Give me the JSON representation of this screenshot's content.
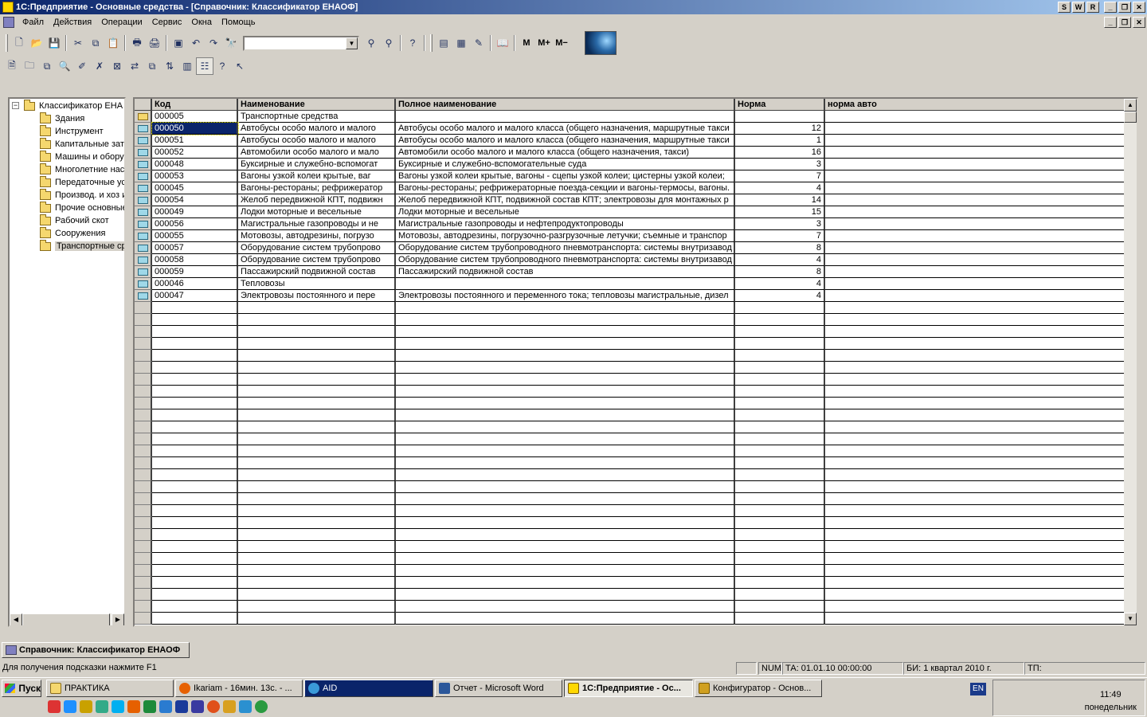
{
  "window": {
    "title": "1С:Предприятие - Основные средства - [Справочник: Классификатор ЕНАОФ]",
    "ctrl_buttons": [
      "S",
      "W",
      "R"
    ]
  },
  "menu": [
    "Файл",
    "Действия",
    "Операции",
    "Сервис",
    "Окна",
    "Помощь"
  ],
  "toolbar": {
    "m_label": "M",
    "mplus_label": "M+",
    "mminus_label": "M−"
  },
  "tree": {
    "root": "Классификатор ЕНА",
    "items": [
      "Здания",
      "Инструмент",
      "Капитальные зат",
      "Машины и обору",
      "Многолетние нас",
      "Передаточные ус",
      "Производ. и хоз и",
      "Прочие основные",
      "Рабочий скот",
      "Сооружения",
      "Транспортные ср"
    ]
  },
  "grid": {
    "columns": [
      "Код",
      "Наименование",
      "Полное наименование",
      "Норма",
      "норма авто"
    ],
    "rows": [
      {
        "code": "000005",
        "name": "Транспортные средства",
        "full": "",
        "norm": ""
      },
      {
        "code": "000050",
        "name": "Автобусы особо малого и малого",
        "full": "Автобусы особо малого и малого класса (общего назначения, маршрутные такси",
        "norm": "12"
      },
      {
        "code": "000051",
        "name": "Автобусы особо малого и малого",
        "full": "Автобусы особо малого и малого класса (общего назначения, маршрутные такси",
        "norm": "1"
      },
      {
        "code": "000052",
        "name": "Автомобили особо малого и мало",
        "full": "Автомобили особо малого и малого класса (общего назначения, такси)",
        "norm": "16"
      },
      {
        "code": "000048",
        "name": "Буксирные и служебно-вспомогат",
        "full": "Буксирные и служебно-вспомогательные суда",
        "norm": "3"
      },
      {
        "code": "000053",
        "name": "Вагоны узкой колеи крытые, ваг",
        "full": "Вагоны узкой колеи крытые, вагоны - сцепы узкой колеи; цистерны узкой колеи;",
        "norm": "7"
      },
      {
        "code": "000045",
        "name": "Вагоны-рестораны; рефрижератор",
        "full": "Вагоны-рестораны; рефрижераторные поезда-секции и вагоны-термосы, вагоны.",
        "norm": "4"
      },
      {
        "code": "000054",
        "name": "Желоб передвижной КПТ, подвижн",
        "full": "Желоб передвижной КПТ, подвижной состав КПТ; электровозы для монтажных р",
        "norm": "14"
      },
      {
        "code": "000049",
        "name": "Лодки моторные и весельные",
        "full": "Лодки моторные и весельные",
        "norm": "15"
      },
      {
        "code": "000056",
        "name": "Магистральные газопроводы и не",
        "full": "Магистральные газопроводы и нефтепродуктопроводы",
        "norm": "3"
      },
      {
        "code": "000055",
        "name": "Мотовозы, автодрезины, погрузо",
        "full": "Мотовозы, автодрезины, погрузочно-разгрузочные летучки; съемные и транспор",
        "norm": "7"
      },
      {
        "code": "000057",
        "name": "Оборудование систем трубопрово",
        "full": "Оборудование систем трубопроводного пневмотранспорта: системы внутризавод",
        "norm": "8"
      },
      {
        "code": "000058",
        "name": "Оборудование систем трубопрово",
        "full": "Оборудование систем трубопроводного пневмотранспорта: системы внутризавод",
        "norm": "4"
      },
      {
        "code": "000059",
        "name": "Пассажирский подвижной состав",
        "full": "Пассажирский подвижной состав",
        "norm": "8"
      },
      {
        "code": "000046",
        "name": "Тепловозы",
        "full": "",
        "norm": "4"
      },
      {
        "code": "000047",
        "name": "Электровозы постоянного и пере",
        "full": "Электровозы постоянного и переменного тока; тепловозы магистральные, дизел",
        "norm": "4"
      }
    ]
  },
  "doc_tab": "Справочник: Классификатор ЕНАОФ",
  "status": {
    "hint": "Для получения подсказки нажмите F1",
    "num": "NUM",
    "ta": "ТА: 01.01.10  00:00:00",
    "bi": "БИ: 1 квартал 2010 г.",
    "tp": "ТП:"
  },
  "taskbar": {
    "start": "Пуск",
    "tasks": [
      "ПРАКТИКА",
      "Ikariam - 16мин. 13с. - ...",
      "AID",
      "Отчет - Microsoft Word",
      "1С:Предприятие - Ос...",
      "Конфигуратор - Основ..."
    ],
    "lang": "EN",
    "time": "11:49",
    "day": "понедельник"
  }
}
